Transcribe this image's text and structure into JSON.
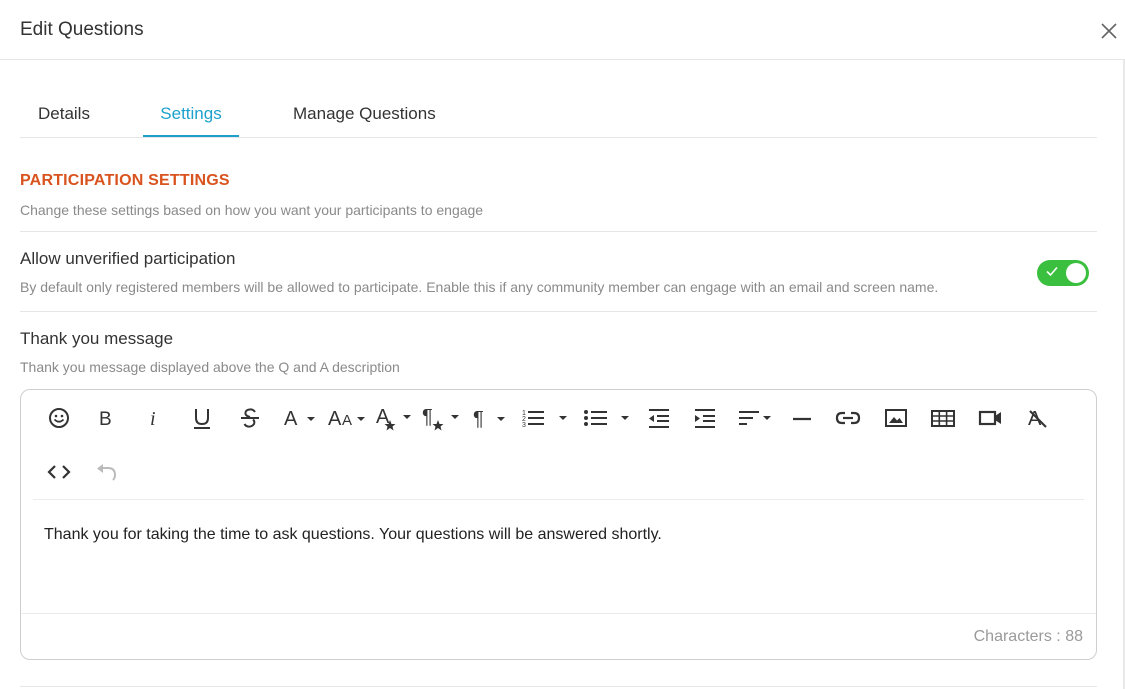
{
  "dialog": {
    "title": "Edit Questions"
  },
  "tabs": [
    {
      "label": "Details"
    },
    {
      "label": "Settings",
      "active": true
    },
    {
      "label": "Manage Questions"
    }
  ],
  "participation": {
    "title": "PARTICIPATION SETTINGS",
    "subtitle": "Change these settings based on how you want your participants to engage"
  },
  "unverified": {
    "title": "Allow unverified participation",
    "description": "By default only registered members will be allowed to participate. Enable this if any community member can engage with an email and screen name.",
    "enabled": true
  },
  "thank_you": {
    "title": "Thank you message",
    "description": "Thank you message displayed above the Q and A description"
  },
  "editor": {
    "content": "Thank you for taking the time to ask questions. Your questions will be answered shortly.",
    "char_count": "Characters : 88",
    "toolbar_icons": [
      "emoticon-icon",
      "bold-icon",
      "italic-icon",
      "underline-icon",
      "strikethrough-icon",
      "font-family-icon",
      "font-size-icon",
      "text-color-icon",
      "paragraph-format-icon",
      "paragraph-style-icon",
      "ordered-list-icon",
      "unordered-list-icon",
      "outdent-icon",
      "indent-icon",
      "align-icon",
      "horizontal-line-icon",
      "link-icon",
      "image-icon",
      "table-icon",
      "video-icon",
      "clear-formatting-icon",
      "code-view-icon",
      "undo-icon"
    ]
  },
  "colors": {
    "accent": "#1ba1cc",
    "section_title": "#d9531e",
    "toggle_on": "#3bbf3f"
  }
}
